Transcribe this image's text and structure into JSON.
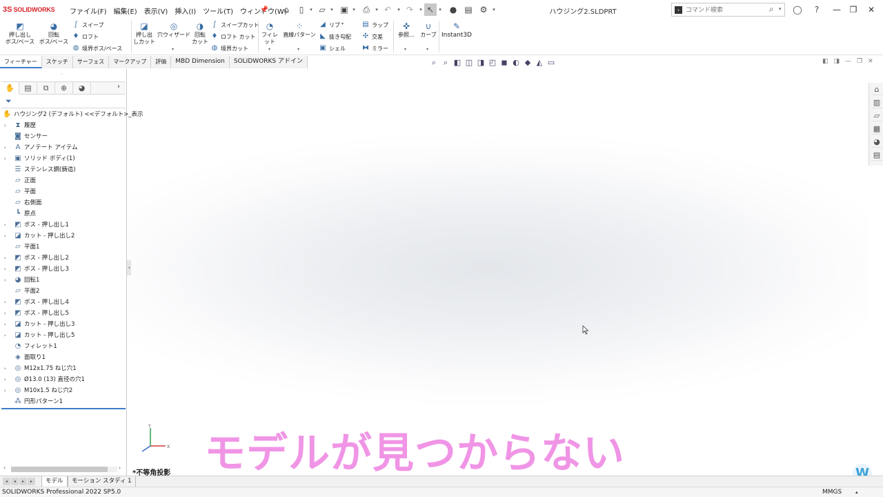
{
  "app": {
    "logo_mark": "3S",
    "logo_text": "SOLIDWORKS",
    "document_title": "ハウジング2.SLDPRT",
    "menu": [
      "ファイル(F)",
      "編集(E)",
      "表示(V)",
      "挿入(I)",
      "ツール(T)",
      "ウィンドウ(W)"
    ],
    "search_placeholder": "コマンド検索",
    "window_buttons": [
      "—",
      "❐",
      "✕"
    ]
  },
  "ribbon": {
    "extrude_boss": "押し出し\nボス/ベース",
    "revolve_boss": "回転\nボス/ベース",
    "sweep": "スイープ",
    "loft": "ロフト",
    "boundary_boss": "境界ボス/ベース",
    "extrude_cut": "押し出\nしカット",
    "hole_wizard": "穴ウィザード",
    "revolve_cut": "回転\nカット",
    "swept_cut": "スイープカット",
    "lofted_cut": "ロフト カット",
    "boundary_cut": "境界カット",
    "fillet": "フィレット",
    "linear_pattern": "直線パターン",
    "rib": "リブ",
    "draft": "抜き勾配",
    "shell": "シェル",
    "wrap": "ラップ",
    "intersect": "交差",
    "mirror": "ミラー",
    "reference": "参照…",
    "curves": "カーブ",
    "instant3d": "Instant3D"
  },
  "tabs": [
    {
      "label": "フィーチャー",
      "active": true
    },
    {
      "label": "スケッチ",
      "active": false
    },
    {
      "label": "サーフェス",
      "active": false
    },
    {
      "label": "マークアップ",
      "active": false
    },
    {
      "label": "評価",
      "active": false
    },
    {
      "label": "MBD Dimension",
      "active": false
    },
    {
      "label": "SOLIDWORKS アドイン",
      "active": false
    }
  ],
  "tree": {
    "root": "ハウジング2 (デフォルト) <<デフォルト>_表示",
    "items": [
      {
        "label": "履歴",
        "icon": "history-icon",
        "expand": true
      },
      {
        "label": "センサー",
        "icon": "sensor-icon",
        "expand": false
      },
      {
        "label": "アノテート アイテム",
        "icon": "annotation-icon",
        "expand": true
      },
      {
        "label": "ソリッド ボディ(1)",
        "icon": "solid-body-icon",
        "expand": true
      },
      {
        "label": "ステンレス鋼(鋳造)",
        "icon": "material-icon",
        "expand": false
      },
      {
        "label": "正面",
        "icon": "plane-icon",
        "expand": false
      },
      {
        "label": "平面",
        "icon": "plane-icon",
        "expand": false
      },
      {
        "label": "右側面",
        "icon": "plane-icon",
        "expand": false
      },
      {
        "label": "原点",
        "icon": "origin-icon",
        "expand": false
      },
      {
        "label": "ボス - 押し出し1",
        "icon": "extrude-icon",
        "expand": true
      },
      {
        "label": "カット - 押し出し2",
        "icon": "cut-extrude-icon",
        "expand": true
      },
      {
        "label": "平面1",
        "icon": "plane-icon",
        "expand": false
      },
      {
        "label": "ボス - 押し出し2",
        "icon": "extrude-icon",
        "expand": true
      },
      {
        "label": "ボス - 押し出し3",
        "icon": "extrude-icon",
        "expand": true
      },
      {
        "label": "回転1",
        "icon": "revolve-icon",
        "expand": true
      },
      {
        "label": "平面2",
        "icon": "plane-icon",
        "expand": false
      },
      {
        "label": "ボス - 押し出し4",
        "icon": "extrude-icon",
        "expand": true
      },
      {
        "label": "ボス - 押し出し5",
        "icon": "extrude-icon",
        "expand": true
      },
      {
        "label": "カット - 押し出し3",
        "icon": "cut-extrude-icon",
        "expand": true
      },
      {
        "label": "カット - 押し出し5",
        "icon": "cut-extrude-icon",
        "expand": true
      },
      {
        "label": "フィレット1",
        "icon": "fillet-icon",
        "expand": false
      },
      {
        "label": "面取り1",
        "icon": "chamfer-icon",
        "expand": false
      },
      {
        "label": "M12x1.75 ねじ穴1",
        "icon": "hole-icon",
        "expand": true
      },
      {
        "label": "Ø13.0 (13) 直径の穴1",
        "icon": "hole-icon",
        "expand": true
      },
      {
        "label": "M10x1.5 ねじ穴2",
        "icon": "hole-icon",
        "expand": true
      },
      {
        "label": "円形パターン1",
        "icon": "circular-pattern-icon",
        "expand": false
      }
    ]
  },
  "bottom_tabs": [
    {
      "label": "モデル",
      "active": true
    },
    {
      "label": "モーション スタディ 1",
      "active": false
    }
  ],
  "viewport": {
    "projection_label": "*不等角投影",
    "caption": "モデルが見つからない",
    "triad_axis_y": "Y",
    "triad_axis_x": "X",
    "watermark": "W"
  },
  "status": {
    "text": "SOLIDWORKS Professional 2022 SP5.0",
    "units": "MMGS"
  }
}
